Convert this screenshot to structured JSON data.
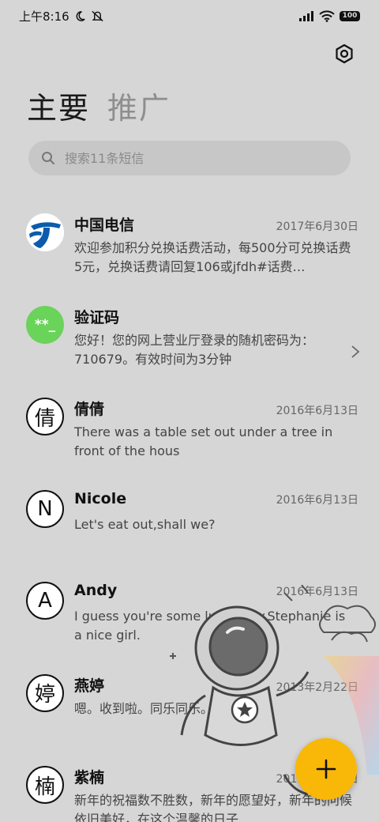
{
  "status_bar": {
    "time": "上午8:16",
    "battery": "100"
  },
  "tabs": [
    {
      "label": "主要",
      "active": true
    },
    {
      "label": "推广",
      "active": false
    }
  ],
  "search": {
    "placeholder": "搜索11条短信"
  },
  "conversations": [
    {
      "sender": "中国电信",
      "date": "2017年6月30日",
      "preview": "欢迎参加积分兑换话费活动，每500分可兑换话费5元，兑换话费请回复106或jfdh#话费…",
      "avatar": "china-telecom-logo"
    },
    {
      "sender": "验证码",
      "date": "",
      "preview": "您好！您的网上营业厅登录的随机密码为：710679。有效时间为3分钟",
      "avatar_text": "**_"
    },
    {
      "sender": "倩倩",
      "date": "2016年6月13日",
      "preview": "There was a table set out under a tree in front of the hous",
      "avatar_text": "倩"
    },
    {
      "sender": "Nicole",
      "date": "2016年6月13日",
      "preview": "Let's eat out,shall we?",
      "avatar_text": "N"
    },
    {
      "sender": "Andy",
      "date": "2016年6月13日",
      "preview": "I guess you're some lucky guy.Stephanie is a nice girl.",
      "avatar_text": "A"
    },
    {
      "sender": "燕婷",
      "date": "2013年2月22日",
      "preview": "嗯。收到啦。同乐同乐。",
      "avatar_text": "婷"
    },
    {
      "sender": "紫楠",
      "date": "2013年2月22日",
      "preview": "新年的祝福数不胜数，新年的愿望好，新年的问候依旧美好，在这个温馨的日子",
      "avatar_text": "楠"
    }
  ],
  "colors": {
    "background": "#d6d6d6",
    "fab": "#f9b708",
    "code_avatar": "#6ad35a",
    "telecom_blue": "#0b5cab"
  }
}
